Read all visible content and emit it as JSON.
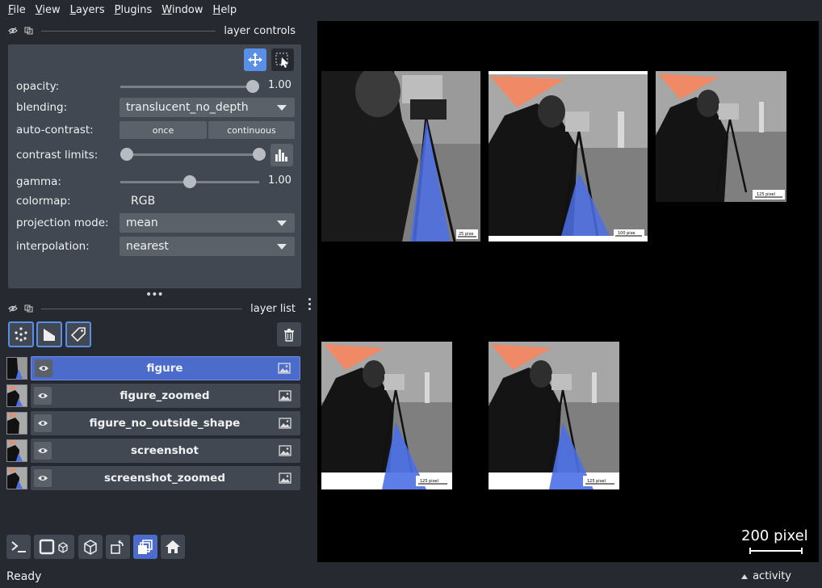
{
  "menu": [
    {
      "mnemonic": "F",
      "rest": "ile"
    },
    {
      "mnemonic": "V",
      "rest": "iew"
    },
    {
      "mnemonic": "L",
      "rest": "ayers"
    },
    {
      "mnemonic": "P",
      "rest": "lugins"
    },
    {
      "mnemonic": "W",
      "rest": "indow"
    },
    {
      "mnemonic": "H",
      "rest": "elp"
    }
  ],
  "layer_controls": {
    "title": "layer controls",
    "opacity": {
      "label": "opacity:",
      "value_text": "1.00",
      "value": 1.0
    },
    "blending": {
      "label": "blending:",
      "value": "translucent_no_depth"
    },
    "auto_contrast": {
      "label": "auto-contrast:",
      "once": "once",
      "continuous": "continuous"
    },
    "contrast_limits": {
      "label": "contrast limits:",
      "low": 0.0,
      "high": 1.0
    },
    "gamma": {
      "label": "gamma:",
      "value_text": "1.00",
      "value": 0.5
    },
    "colormap": {
      "label": "colormap:",
      "value": "RGB"
    },
    "projection_mode": {
      "label": "projection mode:",
      "value": "mean"
    },
    "interpolation": {
      "label": "interpolation:",
      "value": "nearest"
    }
  },
  "layer_list": {
    "title": "layer list",
    "layers": [
      {
        "name": "figure",
        "selected": true
      },
      {
        "name": "figure_zoomed",
        "selected": false
      },
      {
        "name": "figure_no_outside_shape",
        "selected": false
      },
      {
        "name": "screenshot",
        "selected": false
      },
      {
        "name": "screenshot_zoomed",
        "selected": false
      }
    ]
  },
  "canvas": {
    "scalebar_label": "200 pixel",
    "images": [
      {
        "name": "figure",
        "scale_label": "25 pixe"
      },
      {
        "name": "figure_zoomed",
        "scale_label": "100 pixe"
      },
      {
        "name": "figure_no_outside_shape",
        "scale_label": "125 pixel"
      },
      {
        "name": "screenshot",
        "scale_label": "125 pixel"
      },
      {
        "name": "screenshot_zoomed",
        "scale_label": "125 pixel"
      }
    ]
  },
  "status": {
    "text": "Ready",
    "activity": "activity"
  },
  "colors": {
    "accent": "#5a8fe8",
    "selected_layer": "#4c6ccc",
    "panel": "#414851",
    "background": "#262930",
    "shape_orange": "#f08a66",
    "shape_blue": "#4b6fe6"
  }
}
